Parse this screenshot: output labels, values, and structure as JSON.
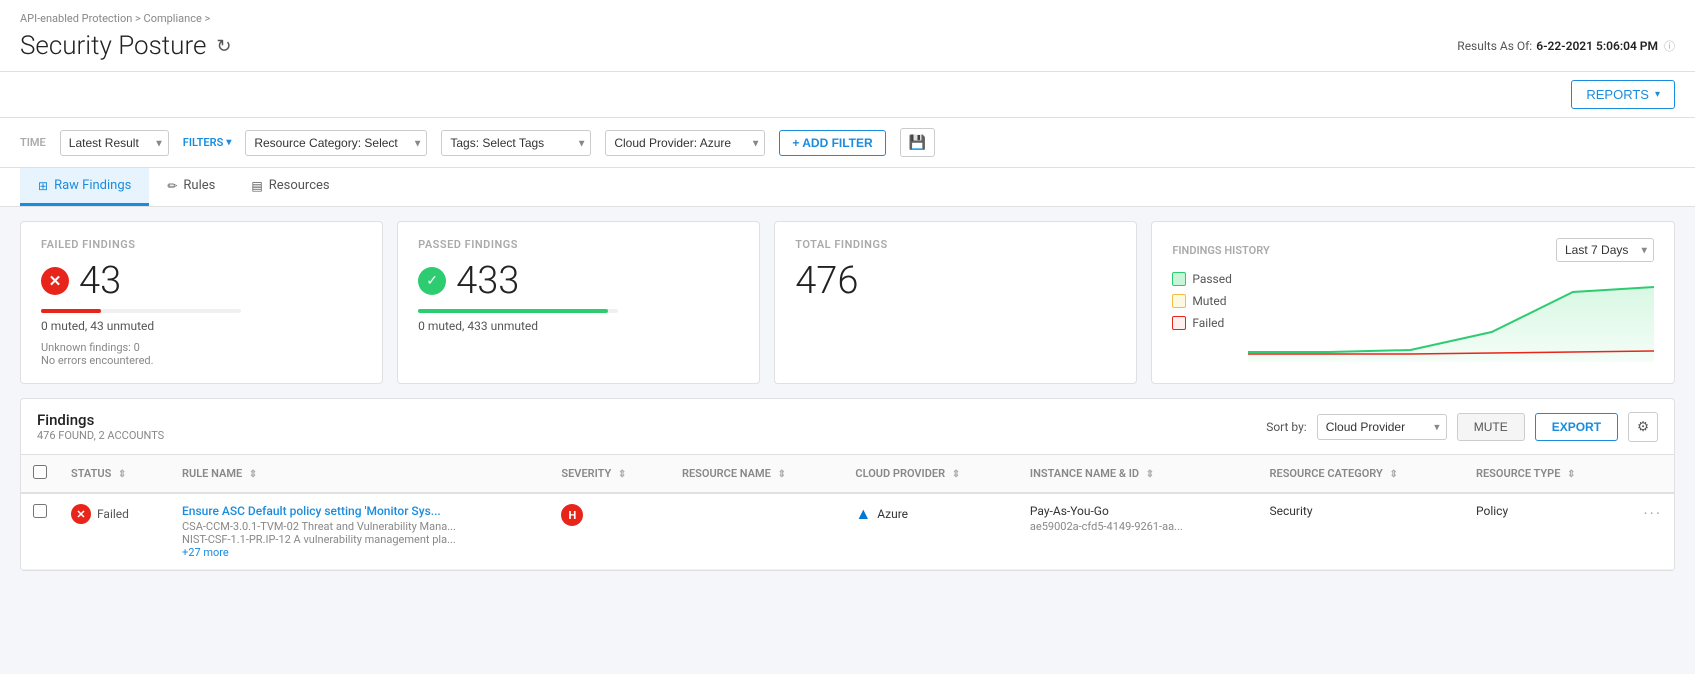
{
  "breadcrumb": {
    "items": [
      "API-enabled Protection",
      "Compliance",
      ""
    ]
  },
  "page": {
    "title": "Security Posture",
    "results_as_of_label": "Results As Of:",
    "results_as_of_value": "6-22-2021 5:06:04 PM"
  },
  "toolbar": {
    "reports_label": "REPORTS"
  },
  "time_section": {
    "label": "TIME",
    "time_select": "Latest Result"
  },
  "filters_section": {
    "label": "FILTERS",
    "resource_category_label": "Resource Category:",
    "resource_category_placeholder": "Select",
    "tags_label": "Tags:",
    "tags_placeholder": "Select Tags",
    "cloud_provider_label": "Cloud Provider:",
    "cloud_provider_value": "Azure",
    "add_filter_label": "+ ADD FILTER"
  },
  "tabs": [
    {
      "id": "raw-findings",
      "label": "Raw Findings",
      "active": true
    },
    {
      "id": "rules",
      "label": "Rules",
      "active": false
    },
    {
      "id": "resources",
      "label": "Resources",
      "active": false
    }
  ],
  "failed_findings": {
    "label": "FAILED FINDINGS",
    "value": "43",
    "sub": "0 muted, 43 unmuted",
    "unknown": "Unknown findings: 0",
    "no_errors": "No errors encountered."
  },
  "passed_findings": {
    "label": "PASSED FINDINGS",
    "value": "433",
    "sub": "0 muted, 433 unmuted"
  },
  "total_findings": {
    "label": "TOTAL FINDINGS",
    "value": "476"
  },
  "findings_history": {
    "label": "FINDINGS HISTORY",
    "time_range": "Last 7 Days",
    "legend": [
      {
        "id": "passed",
        "label": "Passed"
      },
      {
        "id": "muted",
        "label": "Muted"
      },
      {
        "id": "failed",
        "label": "Failed"
      }
    ]
  },
  "findings_table": {
    "title": "Findings",
    "subtitle": "476 FOUND, 2 ACCOUNTS",
    "sort_by_label": "Sort by:",
    "sort_by_value": "Cloud Provider",
    "mute_label": "MUTE",
    "export_label": "EXPORT",
    "columns": [
      {
        "id": "status",
        "label": "STATUS"
      },
      {
        "id": "rule-name",
        "label": "RULE NAME"
      },
      {
        "id": "severity",
        "label": "SEVERITY"
      },
      {
        "id": "resource-name",
        "label": "RESOURCE NAME"
      },
      {
        "id": "cloud-provider",
        "label": "CLOUD PROVIDER"
      },
      {
        "id": "instance-name",
        "label": "INSTANCE NAME & ID"
      },
      {
        "id": "resource-category",
        "label": "RESOURCE CATEGORY"
      },
      {
        "id": "resource-type",
        "label": "RESOURCE TYPE"
      }
    ],
    "rows": [
      {
        "status": "Failed",
        "rule_name": "Ensure ASC Default policy setting 'Monitor Sys...",
        "rule_sub1": "CSA-CCM-3.0.1-TVM-02 Threat and Vulnerability Mana...",
        "rule_sub2": "NIST-CSF-1.1-PR.IP-12 A vulnerability management pla...",
        "rule_sub3": "+27 more",
        "severity": "H",
        "resource_name": "",
        "cloud_provider": "Azure",
        "instance_name": "Pay-As-You-Go",
        "instance_id": "ae59002a-cfd5-4149-9261-aa...",
        "resource_category": "Security",
        "resource_type": "Policy",
        "menu": "···"
      }
    ]
  }
}
